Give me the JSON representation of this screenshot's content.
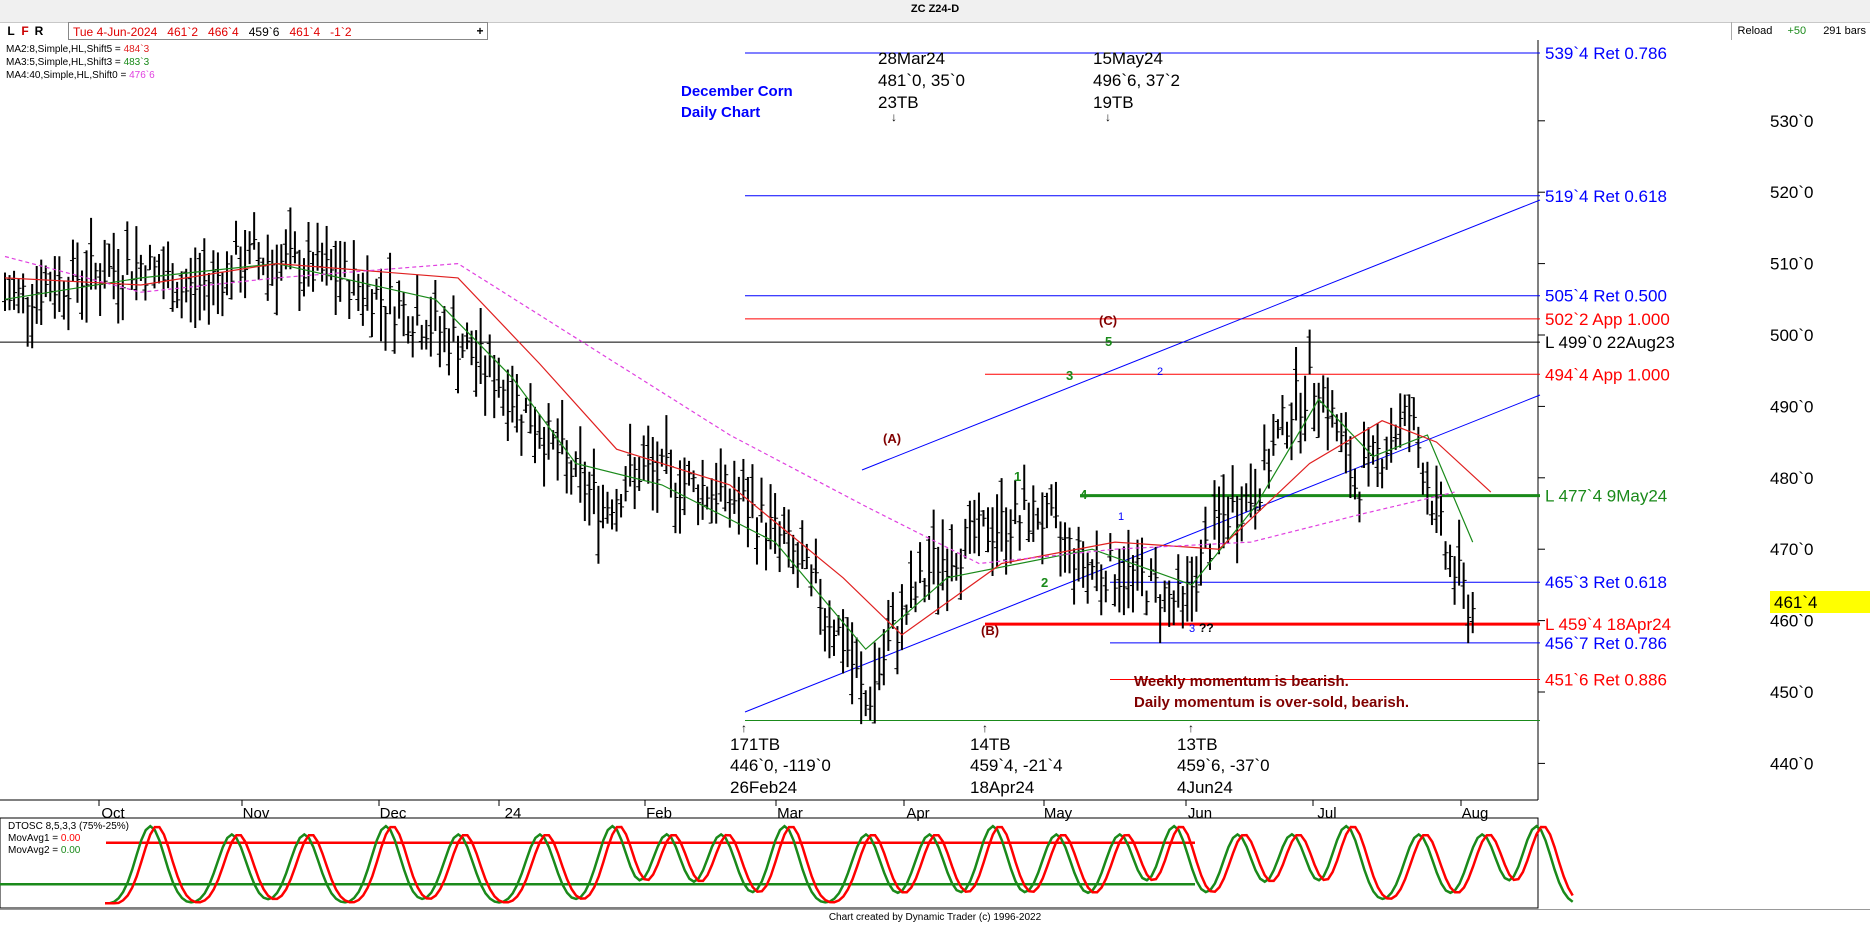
{
  "window": {
    "title": "ZC Z24-D",
    "date_box": "Tue 4-Jun-2024",
    "ohlc": [
      "461`2",
      "466`4",
      "459`6",
      "461`4",
      "-1`2"
    ],
    "tab_buttons": [
      "L",
      "F",
      "R"
    ],
    "add_symbol": "+",
    "reload_label": "Reload",
    "reload_delta": "+50",
    "bars_count": "291 bars",
    "footer": "Chart created by Dynamic Trader  (c)  1996-2022"
  },
  "moving_averages": [
    {
      "label": "MA2:8,Simple,HL,Shift5 = ",
      "value": "484`3",
      "color": "#e02020"
    },
    {
      "label": "MA3:5,Simple,HL,Shift3 = ",
      "value": "483`3",
      "color": "#1a8a1a"
    },
    {
      "label": "MA4:40,Simple,HL,Shift0 = ",
      "value": "476`6",
      "color": "#e040e0"
    }
  ],
  "chart_title_lines": [
    "December Corn",
    "Daily Chart"
  ],
  "chart_data": {
    "type": "ohlc-bar",
    "symbol": "ZC Z24-D",
    "x_tick_labels": [
      "Oct",
      "Nov",
      "Dec",
      "24",
      "Feb",
      "Mar",
      "Apr",
      "May",
      "Jun",
      "Jul",
      "Aug"
    ],
    "y_tick_labels": [
      "440`0",
      "450`0",
      "460`0",
      "470`0",
      "480`0",
      "490`0",
      "500`0",
      "510`0",
      "520`0",
      "530`0"
    ],
    "ylim": [
      432,
      539
    ],
    "last_price_label": "461`4",
    "price_points": [
      {
        "x": 0,
        "y": 505
      },
      {
        "x": 15,
        "y": 508
      },
      {
        "x": 30,
        "y": 510
      },
      {
        "x": 40,
        "y": 506
      },
      {
        "x": 55,
        "y": 511
      },
      {
        "x": 75,
        "y": 508
      },
      {
        "x": 90,
        "y": 503
      },
      {
        "x": 100,
        "y": 499
      },
      {
        "x": 110,
        "y": 493
      },
      {
        "x": 118,
        "y": 487
      },
      {
        "x": 126,
        "y": 480
      },
      {
        "x": 132,
        "y": 476
      },
      {
        "x": 140,
        "y": 481
      },
      {
        "x": 152,
        "y": 479
      },
      {
        "x": 162,
        "y": 477
      },
      {
        "x": 172,
        "y": 471
      },
      {
        "x": 180,
        "y": 463
      },
      {
        "x": 186,
        "y": 456
      },
      {
        "x": 190,
        "y": 448
      },
      {
        "x": 196,
        "y": 458
      },
      {
        "x": 205,
        "y": 468
      },
      {
        "x": 218,
        "y": 473
      },
      {
        "x": 228,
        "y": 475
      },
      {
        "x": 238,
        "y": 468
      },
      {
        "x": 250,
        "y": 466
      },
      {
        "x": 260,
        "y": 462
      },
      {
        "x": 268,
        "y": 474
      },
      {
        "x": 276,
        "y": 478
      },
      {
        "x": 284,
        "y": 490
      },
      {
        "x": 290,
        "y": 494
      },
      {
        "x": 298,
        "y": 479
      },
      {
        "x": 304,
        "y": 484
      },
      {
        "x": 310,
        "y": 489
      },
      {
        "x": 318,
        "y": 470
      },
      {
        "x": 322,
        "y": 464
      },
      {
        "x": 324,
        "y": 461.5
      }
    ],
    "overlay_lines": [
      {
        "kind": "ma",
        "name": "MA3 (5)",
        "color": "#1a8a1a",
        "points": [
          {
            "x": 0,
            "y": 505
          },
          {
            "x": 30,
            "y": 508
          },
          {
            "x": 60,
            "y": 510
          },
          {
            "x": 95,
            "y": 505
          },
          {
            "x": 112,
            "y": 494
          },
          {
            "x": 126,
            "y": 482
          },
          {
            "x": 145,
            "y": 479
          },
          {
            "x": 170,
            "y": 471
          },
          {
            "x": 190,
            "y": 456
          },
          {
            "x": 208,
            "y": 466
          },
          {
            "x": 240,
            "y": 470
          },
          {
            "x": 262,
            "y": 465
          },
          {
            "x": 276,
            "y": 476
          },
          {
            "x": 290,
            "y": 491
          },
          {
            "x": 302,
            "y": 483
          },
          {
            "x": 314,
            "y": 486
          },
          {
            "x": 324,
            "y": 471
          }
        ]
      },
      {
        "kind": "ma",
        "name": "MA2 (8)",
        "color": "#e02020",
        "points": [
          {
            "x": 0,
            "y": 508
          },
          {
            "x": 30,
            "y": 507
          },
          {
            "x": 60,
            "y": 510
          },
          {
            "x": 100,
            "y": 508
          },
          {
            "x": 118,
            "y": 496
          },
          {
            "x": 135,
            "y": 484
          },
          {
            "x": 160,
            "y": 479
          },
          {
            "x": 185,
            "y": 466
          },
          {
            "x": 198,
            "y": 458
          },
          {
            "x": 220,
            "y": 468
          },
          {
            "x": 245,
            "y": 471
          },
          {
            "x": 268,
            "y": 470
          },
          {
            "x": 288,
            "y": 482
          },
          {
            "x": 304,
            "y": 488
          },
          {
            "x": 316,
            "y": 485
          },
          {
            "x": 328,
            "y": 478
          }
        ]
      },
      {
        "kind": "ma",
        "name": "MA4 (40)",
        "color": "#e040e0",
        "points": [
          {
            "x": 0,
            "y": 511
          },
          {
            "x": 30,
            "y": 506
          },
          {
            "x": 60,
            "y": 508
          },
          {
            "x": 100,
            "y": 510
          },
          {
            "x": 130,
            "y": 498
          },
          {
            "x": 160,
            "y": 486
          },
          {
            "x": 190,
            "y": 476
          },
          {
            "x": 215,
            "y": 468
          },
          {
            "x": 245,
            "y": 470
          },
          {
            "x": 275,
            "y": 471
          },
          {
            "x": 300,
            "y": 475
          },
          {
            "x": 320,
            "y": 478
          }
        ]
      }
    ],
    "retracement_levels": [
      {
        "price": 539.5,
        "label": "539`4 Ret 0.786",
        "color": "#0000ff"
      },
      {
        "price": 519.5,
        "label": "519`4 Ret 0.618",
        "color": "#0000ff"
      },
      {
        "price": 505.5,
        "label": "505`4 Ret 0.500",
        "color": "#0000ff"
      },
      {
        "price": 502.25,
        "label": "502`2 App 1.000",
        "color": "#ff0000"
      },
      {
        "price": 499.0,
        "label": "L 499`0 22Aug23",
        "color": "#000000"
      },
      {
        "price": 494.5,
        "label": "494`4 App 1.000",
        "color": "#ff0000"
      },
      {
        "price": 477.5,
        "label": "L 477`4 9May24",
        "color": "#1a8a1a"
      },
      {
        "price": 465.375,
        "label": "465`3 Ret 0.618",
        "color": "#0000ff"
      },
      {
        "price": 459.5,
        "label": "L 459`4 18Apr24",
        "color": "#ff0000"
      },
      {
        "price": 456.875,
        "label": "456`7 Ret 0.786",
        "color": "#0000ff"
      },
      {
        "price": 451.75,
        "label": "451`6 Ret 0.886",
        "color": "#ff0000"
      }
    ],
    "time_annotations": [
      {
        "lines": [
          "28Mar24",
          "481`0, 35`0",
          "23TB"
        ],
        "arrow": "↓"
      },
      {
        "lines": [
          "15May24",
          "496`6, 37`2",
          "19TB"
        ],
        "arrow": "↓"
      },
      {
        "lines": [
          "171TB",
          "446`0, -119`0",
          "26Feb24"
        ],
        "arrow": "↑"
      },
      {
        "lines": [
          "14TB",
          "459`4, -21`4",
          "18Apr24"
        ],
        "arrow": "↑"
      },
      {
        "lines": [
          "13TB",
          "459`6, -37`0",
          "4Jun24"
        ],
        "arrow": "↑"
      }
    ],
    "wave_labels": [
      "(A)",
      "(B)",
      "(C)",
      "1",
      "2",
      "3",
      "4",
      "5",
      "1",
      "2",
      "3",
      "??"
    ],
    "comments": [
      "Weekly momentum is bearish.",
      "Daily momentum is over-sold, bearish."
    ],
    "oscillator": {
      "title": "DTOSC 8,5,3,3 (75%-25%)",
      "mov_avg1_label": "MovAvg1 = ",
      "mov_avg1_value": "0.00",
      "mov_avg2_label": "MovAvg2 = ",
      "mov_avg2_value": "0.00",
      "upper_band": 75,
      "lower_band": 25
    }
  },
  "colors": {
    "bar_color": "#000000",
    "price_tag_bg": "#ffff00",
    "blue": "#0000ff",
    "red": "#ff0000",
    "green": "#1a8a1a",
    "maroon": "#800000"
  }
}
